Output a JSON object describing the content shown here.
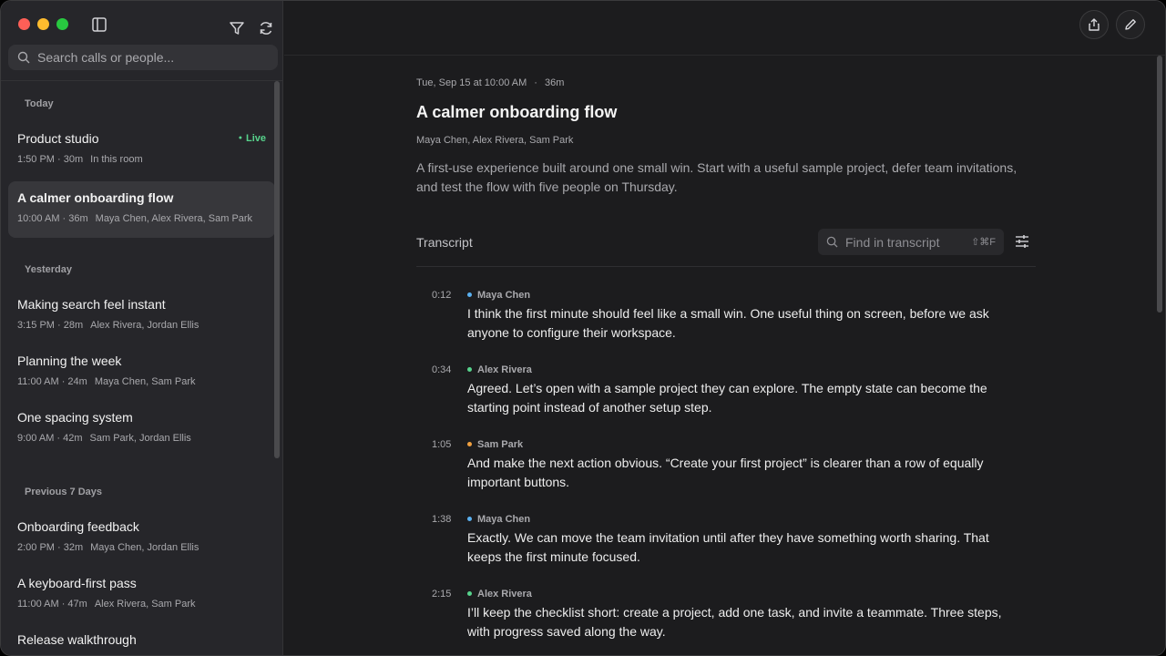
{
  "sidebar": {
    "search_placeholder": "Search calls or people...",
    "groups": {
      "today": "Today",
      "yesterday": "Yesterday",
      "previous": "Previous 7 Days"
    },
    "items": [
      {
        "title": "Product studio",
        "time": "1:50 PM · 30m",
        "people": "In this room",
        "badge": "Live"
      },
      {
        "title": "A calmer onboarding flow",
        "time": "10:00 AM · 36m",
        "people": "Maya Chen, Alex Rivera, Sam Park"
      },
      {
        "title": "Making search feel instant",
        "time": "3:15 PM · 28m",
        "people": "Alex Rivera, Jordan Ellis"
      },
      {
        "title": "Planning the week",
        "time": "11:00 AM · 24m",
        "people": "Maya Chen, Sam Park"
      },
      {
        "title": "One spacing system",
        "time": "9:00 AM · 42m",
        "people": "Sam Park, Jordan Ellis"
      },
      {
        "title": "Onboarding feedback",
        "time": "2:00 PM · 32m",
        "people": "Maya Chen, Jordan Ellis"
      },
      {
        "title": "A keyboard-first pass",
        "time": "11:00 AM · 47m",
        "people": "Alex Rivera, Sam Park"
      },
      {
        "title": "Release walkthrough",
        "time": "",
        "people": ""
      }
    ]
  },
  "call": {
    "date": "Tue, Sep 15 at 10:00 AM",
    "duration": "36m",
    "title": "A calmer onboarding flow",
    "participants": "Maya Chen, Alex Rivera, Sam Park",
    "summary": "A first-use experience built around one small win. Start with a useful sample project, defer team invitations, and test the flow with five people on Thursday."
  },
  "transcript": {
    "label": "Transcript",
    "find_placeholder": "Find in transcript",
    "shortcut": "⇧⌘F",
    "entries": [
      {
        "time": "0:12",
        "speaker": "Maya Chen",
        "text": "I think the first minute should feel like a small win. One useful thing on screen, before we ask anyone to configure their workspace."
      },
      {
        "time": "0:34",
        "speaker": "Alex Rivera",
        "text": "Agreed. Let’s open with a sample project they can explore. The empty state can become the starting point instead of another setup step."
      },
      {
        "time": "1:05",
        "speaker": "Sam Park",
        "text": "And make the next action obvious. “Create your first project” is clearer than a row of equally important buttons."
      },
      {
        "time": "1:38",
        "speaker": "Maya Chen",
        "text": "Exactly. We can move the team invitation until after they have something worth sharing. That keeps the first minute focused."
      },
      {
        "time": "2:15",
        "speaker": "Alex Rivera",
        "text": "I’ll keep the checklist short: create a project, add one task, and invite a teammate. Three steps, with progress saved along the way."
      }
    ]
  },
  "colors": {
    "maya": "#5ab0f0",
    "alex": "#57d38c",
    "sam": "#f0a040",
    "live": "#57d38c"
  }
}
